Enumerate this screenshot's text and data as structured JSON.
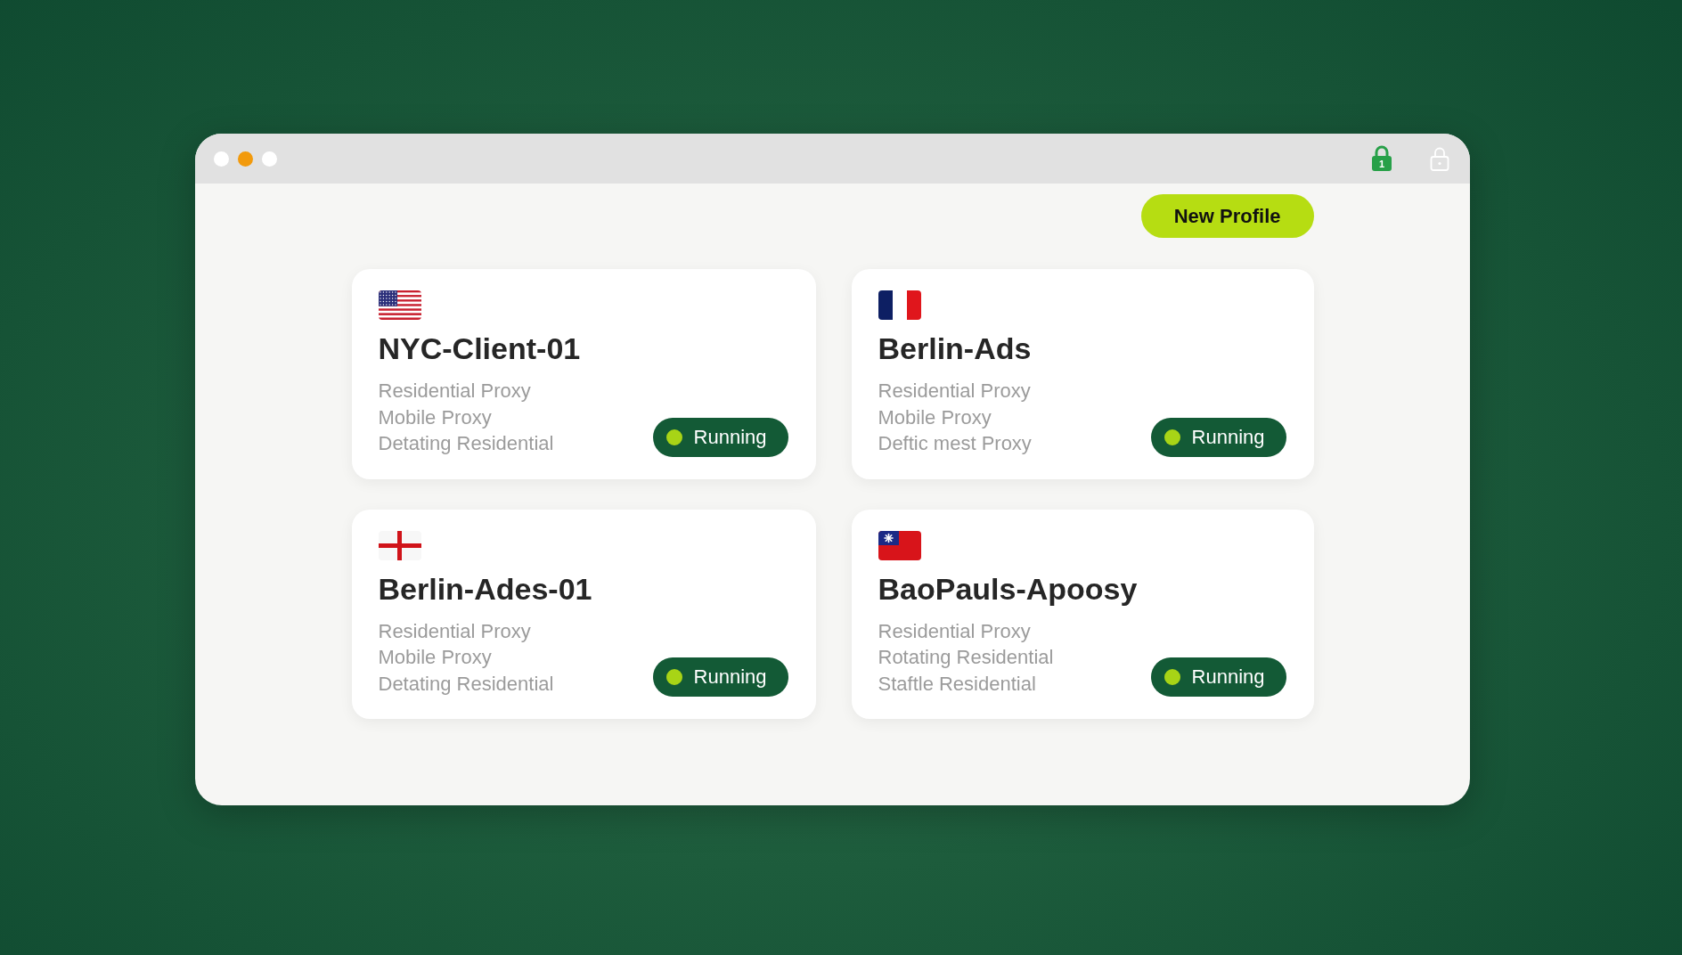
{
  "window": {
    "controls": [
      {
        "color": "#ffffff"
      },
      {
        "color": "#f29a0c"
      },
      {
        "color": "#ffffff"
      }
    ],
    "locks": [
      {
        "active": true,
        "label": "1"
      },
      {
        "active": false
      }
    ]
  },
  "new_profile_button": {
    "label": "New Profile"
  },
  "profiles": [
    {
      "kind": "us",
      "name": "NYC-Client-01",
      "proxies": [
        "Residential Proxy",
        "Mobile Proxy",
        "Detating Residential"
      ],
      "status": "Running"
    },
    {
      "kind": "fr",
      "name": "Berlin-Ads",
      "proxies": [
        "Residential Proxy",
        "Mobile Proxy",
        "Deftic mest Proxy"
      ],
      "status": "Running"
    },
    {
      "kind": "cross",
      "name": "Berlin-Ades-01",
      "proxies": [
        "Residential Proxy",
        "Mobile Proxy",
        "Detating Residential"
      ],
      "status": "Running"
    },
    {
      "kind": "tw",
      "name": "BaoPauls-Apoosy",
      "proxies": [
        "Residential Proxy",
        "Rotating Residential",
        "Staftle Residential"
      ],
      "status": "Running"
    }
  ]
}
